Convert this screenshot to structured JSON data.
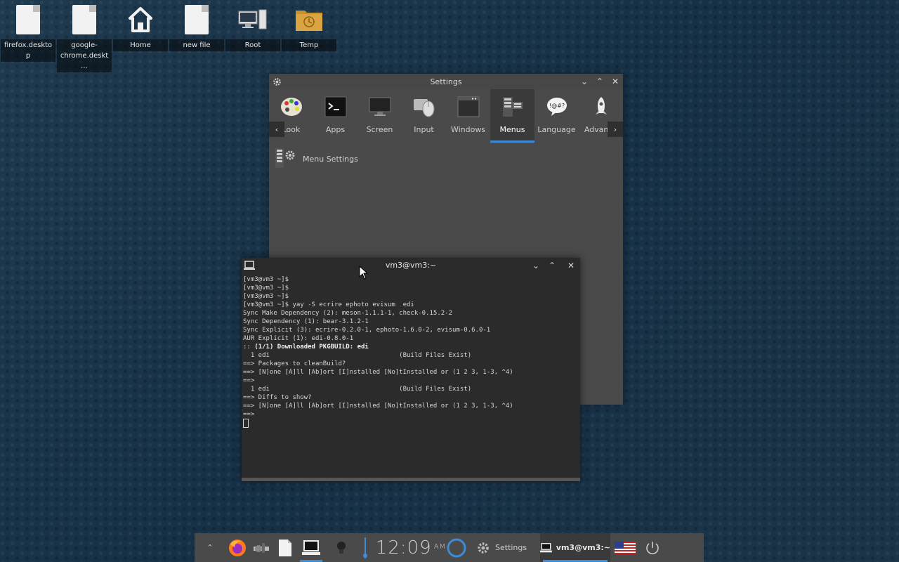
{
  "desktop": {
    "icons": [
      {
        "label": "firefox.desktop"
      },
      {
        "label": "google-chrome.deskt…"
      },
      {
        "label": "Home"
      },
      {
        "label": "new file"
      },
      {
        "label": "Root"
      },
      {
        "label": "Temp"
      }
    ]
  },
  "settings_window": {
    "title": "Settings",
    "tabs": [
      {
        "label": "Look",
        "icon": "palette-icon"
      },
      {
        "label": "Apps",
        "icon": "terminal-app-icon"
      },
      {
        "label": "Screen",
        "icon": "monitor-icon"
      },
      {
        "label": "Input",
        "icon": "mouse-icon"
      },
      {
        "label": "Windows",
        "icon": "window-icon"
      },
      {
        "label": "Menus",
        "icon": "menu-icon",
        "active": true
      },
      {
        "label": "Language",
        "icon": "speech-bubble-icon"
      },
      {
        "label": "Advance",
        "icon": "rocket-icon"
      }
    ],
    "content_item": "Menu Settings"
  },
  "terminal": {
    "title": "vm3@vm3:~",
    "lines": [
      "[vm3@vm3 ~]$",
      "[vm3@vm3 ~]$",
      "[vm3@vm3 ~]$",
      "[vm3@vm3 ~]$ yay -S ecrire ephoto evisum  edi",
      "Sync Make Dependency (2): meson-1.1.1-1, check-0.15.2-2",
      "Sync Dependency (1): bear-3.1.2-1",
      "Sync Explicit (3): ecrire-0.2.0-1, ephoto-1.6.0-2, evisum-0.6.0-1",
      "AUR Explicit (1): edi-0.8.0-1"
    ],
    "bold_line_prefix": ":: ",
    "bold_line": "(1/1) Downloaded PKGBUILD: edi",
    "lines2": [
      "  1 edi                                  (Build Files Exist)",
      "==> Packages to cleanBuild?",
      "==> [N]one [A]ll [Ab]ort [I]nstalled [No]tInstalled or (1 2 3, 1-3, ^4)",
      "==>",
      "  1 edi                                  (Build Files Exist)",
      "==> Diffs to show?",
      "==> [N]one [A]ll [Ab]ort [I]nstalled [No]tInstalled or (1 2 3, 1-3, ^4)",
      "==>"
    ]
  },
  "taskbar": {
    "clock_time": "12:09",
    "clock_ampm": "AM",
    "settings_label": "Settings",
    "terminal_label": "vm3@vm3:~"
  },
  "colors": {
    "accent": "#3e8cd6",
    "panel": "#4a4a4a"
  }
}
